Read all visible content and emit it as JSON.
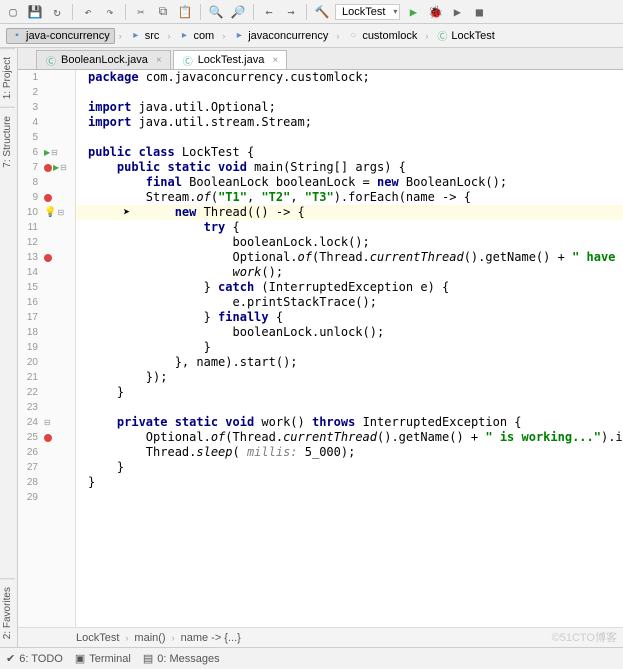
{
  "toolbar": {
    "run_config": "LockTest"
  },
  "breadcrumbs": [
    {
      "icon": "module",
      "label": "java-concurrency"
    },
    {
      "icon": "dir",
      "label": "src"
    },
    {
      "icon": "dir",
      "label": "com"
    },
    {
      "icon": "dir",
      "label": "javaconcurrency"
    },
    {
      "icon": "pkg",
      "label": "customlock"
    },
    {
      "icon": "class",
      "label": "LockTest"
    }
  ],
  "tabs": [
    {
      "label": "BooleanLock.java",
      "active": false
    },
    {
      "label": "LockTest.java",
      "active": true
    }
  ],
  "side_tabs": [
    "1: Project",
    "7: Structure",
    "2: Favorites"
  ],
  "gutter": {
    "1": {},
    "2": {},
    "3": {},
    "4": {},
    "5": {},
    "6": {
      "tri": true,
      "fold": true
    },
    "7": {
      "bp": true,
      "tri": true,
      "fold": true
    },
    "8": {},
    "9": {
      "bp": true
    },
    "10": {
      "bulb": true,
      "fold": true
    },
    "11": {},
    "12": {},
    "13": {
      "bp": true
    },
    "14": {},
    "15": {},
    "16": {},
    "17": {},
    "18": {},
    "19": {},
    "20": {},
    "21": {},
    "22": {},
    "23": {},
    "24": {
      "fold": true
    },
    "25": {
      "bp": true
    },
    "26": {},
    "27": {},
    "28": {},
    "29": {}
  },
  "code": [
    {
      "n": 1,
      "html": "<span class='kw'>package</span> com.javaconcurrency.customlock;"
    },
    {
      "n": 2,
      "html": ""
    },
    {
      "n": 3,
      "html": "<span class='kw'>import</span> java.util.Optional;"
    },
    {
      "n": 4,
      "html": "<span class='kw'>import</span> java.util.stream.Stream;"
    },
    {
      "n": 5,
      "html": ""
    },
    {
      "n": 6,
      "html": "<span class='kw'>public class</span> LockTest {"
    },
    {
      "n": 7,
      "html": "    <span class='kw'>public static void</span> main(String[] args) {"
    },
    {
      "n": 8,
      "html": "        <span class='kw'>final</span> BooleanLock booleanLock = <span class='kw'>new</span> BooleanLock();"
    },
    {
      "n": 9,
      "html": "        Stream.<span class='ital'>of</span>(<span class='str'>\"T1\"</span>, <span class='str'>\"T2\"</span>, <span class='str'>\"T3\"</span>).forEach(name -> {"
    },
    {
      "n": 10,
      "html": "            <span class='kw'>new</span> Thread(() -> {",
      "hl": true
    },
    {
      "n": 11,
      "html": "                <span class='kw'>try</span> {"
    },
    {
      "n": 12,
      "html": "                    booleanLock.lock();"
    },
    {
      "n": 13,
      "html": "                    Optional.<span class='ital'>of</span>(Thread.<span class='ital'>currentThread</span>().getName() + <span class='str'>\" have the </span>"
    },
    {
      "n": 14,
      "html": "                    <span class='ital'>work</span>();"
    },
    {
      "n": 15,
      "html": "                } <span class='kw'>catch</span> (InterruptedException e) {"
    },
    {
      "n": 16,
      "html": "                    e.printStackTrace();"
    },
    {
      "n": 17,
      "html": "                } <span class='kw'>finally</span> {"
    },
    {
      "n": 18,
      "html": "                    booleanLock.unlock();"
    },
    {
      "n": 19,
      "html": "                }"
    },
    {
      "n": 20,
      "html": "            }, name).start();"
    },
    {
      "n": 21,
      "html": "        });"
    },
    {
      "n": 22,
      "html": "    }"
    },
    {
      "n": 23,
      "html": ""
    },
    {
      "n": 24,
      "html": "    <span class='kw'>private static void</span> work() <span class='kw'>throws</span> InterruptedException {"
    },
    {
      "n": 25,
      "html": "        Optional.<span class='ital'>of</span>(Thread.<span class='ital'>currentThread</span>().getName() + <span class='str'>\" is working...\"</span>).ifPre"
    },
    {
      "n": 26,
      "html": "        Thread.<span class='ital'>sleep</span>( <span class='param'>millis:</span> 5_000);"
    },
    {
      "n": 27,
      "html": "    }"
    },
    {
      "n": 28,
      "html": "}"
    },
    {
      "n": 29,
      "html": ""
    }
  ],
  "crumb_bar": [
    "LockTest",
    "main()",
    "name -> {...}"
  ],
  "bottom": {
    "todo": "6: TODO",
    "terminal": "Terminal",
    "messages": "0: Messages"
  },
  "watermark": "©51CTO博客"
}
